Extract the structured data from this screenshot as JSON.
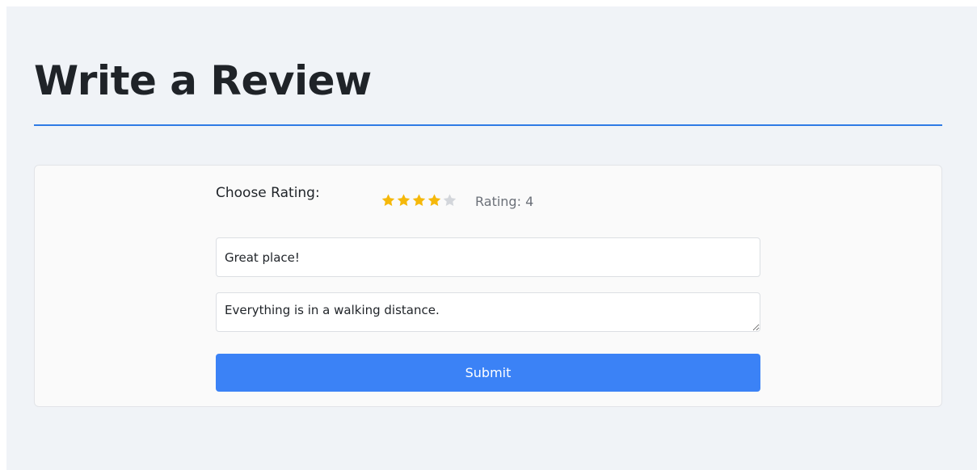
{
  "page": {
    "title": "Write a Review"
  },
  "form": {
    "rating_label": "Choose Rating:",
    "rating_value": 4,
    "rating_max": 5,
    "rating_text": "Rating: 4",
    "title_value": "Great place!",
    "body_value": "Everything is in a walking distance.",
    "submit_label": "Submit"
  },
  "colors": {
    "accent": "#3b82f6",
    "rule": "#2f7be5",
    "star_filled": "#f5b80a",
    "star_empty": "#d3d6db"
  },
  "icons": {
    "star": "star-icon"
  }
}
